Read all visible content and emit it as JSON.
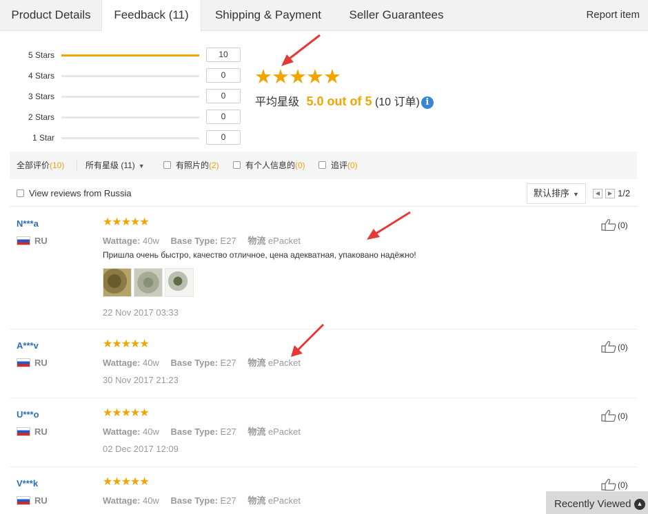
{
  "tabs": [
    {
      "label": "Product Details"
    },
    {
      "label": "Feedback (11)"
    },
    {
      "label": "Shipping & Payment"
    },
    {
      "label": "Seller Guarantees"
    }
  ],
  "report_label": "Report item",
  "histogram": [
    {
      "label": "5 Stars",
      "count": "10",
      "fraction": 1.0
    },
    {
      "label": "4 Stars",
      "count": "0",
      "fraction": 0
    },
    {
      "label": "3 Stars",
      "count": "0",
      "fraction": 0
    },
    {
      "label": "2 Stars",
      "count": "0",
      "fraction": 0
    },
    {
      "label": "1 Star",
      "count": "0",
      "fraction": 0
    }
  ],
  "summary": {
    "stars": "★★★★★",
    "avg_label": "平均星级",
    "avg_value": "5.0 out of 5",
    "orders_text": "(10 订单)",
    "info_glyph": "i"
  },
  "filters": {
    "all_label": "全部评价",
    "all_count": "(10)",
    "stars_label": "所有星级 (11)",
    "photo_label": "有照片的",
    "photo_count": "(2)",
    "personal_label": "有个人信息的",
    "personal_count": "(0)",
    "followup_label": "追评",
    "followup_count": "(0)"
  },
  "sort": {
    "russia_label": "View reviews from Russia",
    "sort_label": "默认排序",
    "page_text": "1/2"
  },
  "reviews": [
    {
      "name": "N***a",
      "country": "RU",
      "stars": "★★★★★",
      "wattage_label": "Wattage:",
      "wattage": "40w",
      "base_label": "Base Type:",
      "base": "E27",
      "logistics_label": "物流",
      "logistics": "ePacket",
      "text": "Пришла очень быстро, качество отличное, цена адекватная, упаковано надёжно!",
      "date": "22 Nov 2017 03:33",
      "likes": "(0)"
    },
    {
      "name": "A***v",
      "country": "RU",
      "stars": "★★★★★",
      "wattage_label": "Wattage:",
      "wattage": "40w",
      "base_label": "Base Type:",
      "base": "E27",
      "logistics_label": "物流",
      "logistics": "ePacket",
      "date": "30 Nov 2017 21:23",
      "likes": "(0)"
    },
    {
      "name": "U***o",
      "country": "RU",
      "stars": "★★★★★",
      "wattage_label": "Wattage:",
      "wattage": "40w",
      "base_label": "Base Type:",
      "base": "E27",
      "logistics_label": "物流",
      "logistics": "ePacket",
      "date": "02 Dec 2017 12:09",
      "likes": "(0)"
    },
    {
      "name": "V***k",
      "country": "RU",
      "stars": "★★★★★",
      "wattage_label": "Wattage:",
      "wattage": "40w",
      "base_label": "Base Type:",
      "base": "E27",
      "logistics_label": "物流",
      "logistics": "ePacket",
      "likes": "(0)"
    }
  ],
  "recently_viewed": "Recently Viewed",
  "colors": {
    "accent": "#f0a500",
    "link": "#2c6fb7",
    "arrow": "#e53935"
  },
  "icons": [
    "thumbs-up-icon",
    "info-icon",
    "chevron-up-icon",
    "russia-flag-icon"
  ]
}
